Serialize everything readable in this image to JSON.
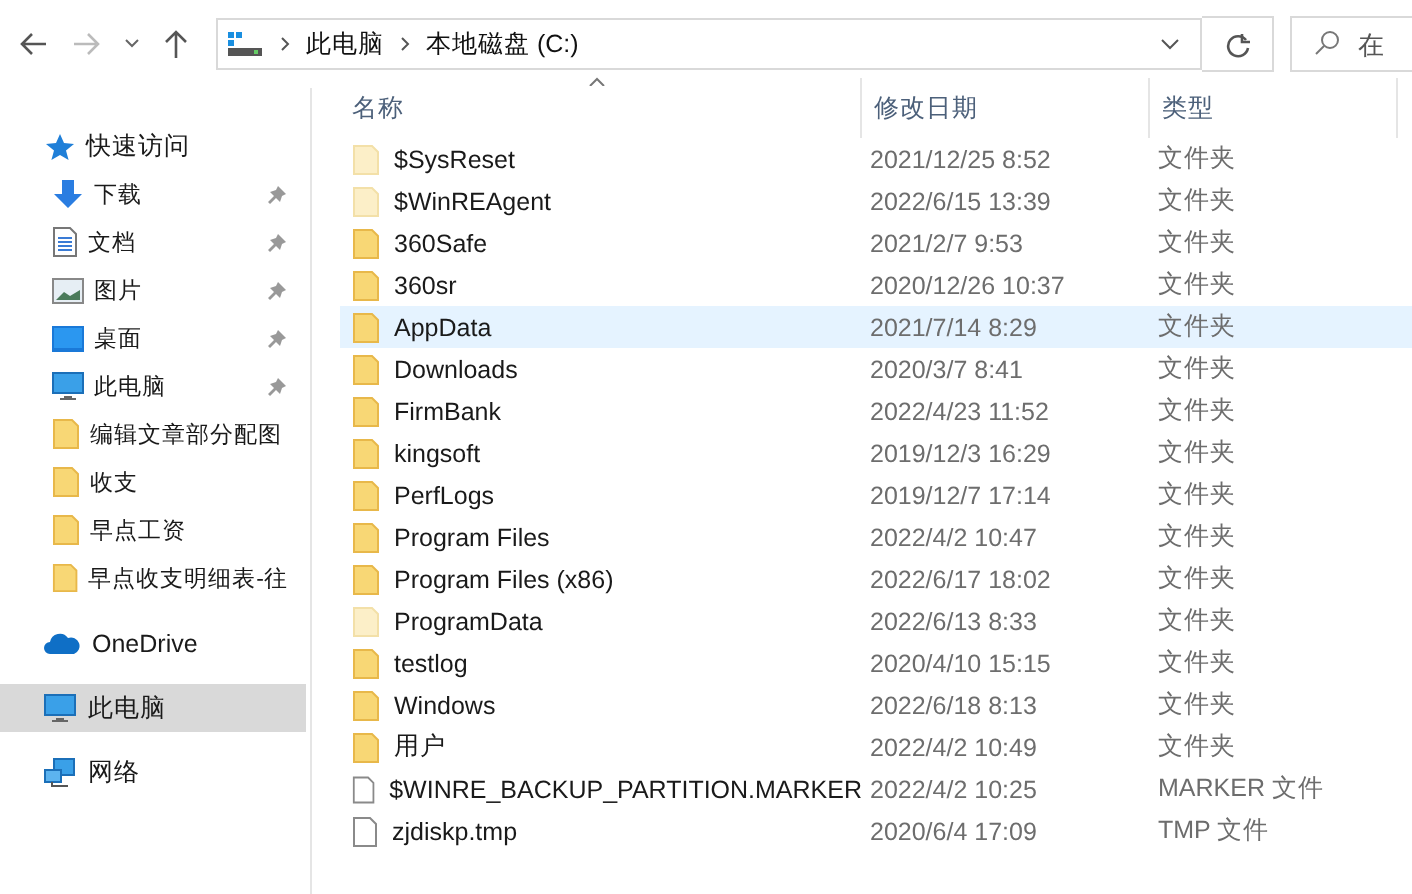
{
  "toolbar": {
    "path": [
      "此电脑",
      "本地磁盘 (C:)"
    ],
    "search": {
      "placeholder": "在"
    }
  },
  "sidebar": {
    "items": [
      {
        "label": "快速访问",
        "kind": "quick",
        "selected": false,
        "children": [
          {
            "label": "下载",
            "kind": "download",
            "pinned": true
          },
          {
            "label": "文档",
            "kind": "document",
            "pinned": true
          },
          {
            "label": "图片",
            "kind": "picture",
            "pinned": true
          },
          {
            "label": "桌面",
            "kind": "desktop",
            "pinned": true
          },
          {
            "label": "此电脑",
            "kind": "pc",
            "pinned": true
          },
          {
            "label": "编辑文章部分配图",
            "kind": "folder",
            "pinned": false
          },
          {
            "label": "收支",
            "kind": "folder",
            "pinned": false
          },
          {
            "label": "早点工资",
            "kind": "folder",
            "pinned": false
          },
          {
            "label": "早点收支明细表-往",
            "kind": "folder",
            "pinned": false
          }
        ]
      },
      {
        "label": "OneDrive",
        "kind": "cloud",
        "selected": false
      },
      {
        "label": "此电脑",
        "kind": "pc",
        "selected": true
      },
      {
        "label": "网络",
        "kind": "network",
        "selected": false
      }
    ]
  },
  "table": {
    "columns": [
      "名称",
      "修改日期",
      "类型"
    ],
    "rows": [
      {
        "name": "$SysReset",
        "date": "2021/12/25 8:52",
        "type": "文件夹",
        "kind": "folder",
        "hidden": true,
        "selected": false
      },
      {
        "name": "$WinREAgent",
        "date": "2022/6/15 13:39",
        "type": "文件夹",
        "kind": "folder",
        "hidden": true,
        "selected": false
      },
      {
        "name": "360Safe",
        "date": "2021/2/7 9:53",
        "type": "文件夹",
        "kind": "folder",
        "hidden": false,
        "selected": false
      },
      {
        "name": "360sr",
        "date": "2020/12/26 10:37",
        "type": "文件夹",
        "kind": "folder",
        "hidden": false,
        "selected": false
      },
      {
        "name": "AppData",
        "date": "2021/7/14 8:29",
        "type": "文件夹",
        "kind": "folder",
        "hidden": false,
        "selected": true
      },
      {
        "name": "Downloads",
        "date": "2020/3/7 8:41",
        "type": "文件夹",
        "kind": "folder",
        "hidden": false,
        "selected": false
      },
      {
        "name": "FirmBank",
        "date": "2022/4/23 11:52",
        "type": "文件夹",
        "kind": "folder",
        "hidden": false,
        "selected": false
      },
      {
        "name": "kingsoft",
        "date": "2019/12/3 16:29",
        "type": "文件夹",
        "kind": "folder",
        "hidden": false,
        "selected": false
      },
      {
        "name": "PerfLogs",
        "date": "2019/12/7 17:14",
        "type": "文件夹",
        "kind": "folder",
        "hidden": false,
        "selected": false
      },
      {
        "name": "Program Files",
        "date": "2022/4/2 10:47",
        "type": "文件夹",
        "kind": "folder",
        "hidden": false,
        "selected": false
      },
      {
        "name": "Program Files (x86)",
        "date": "2022/6/17 18:02",
        "type": "文件夹",
        "kind": "folder",
        "hidden": false,
        "selected": false
      },
      {
        "name": "ProgramData",
        "date": "2022/6/13 8:33",
        "type": "文件夹",
        "kind": "folder",
        "hidden": true,
        "selected": false
      },
      {
        "name": "testlog",
        "date": "2020/4/10 15:15",
        "type": "文件夹",
        "kind": "folder",
        "hidden": false,
        "selected": false
      },
      {
        "name": "Windows",
        "date": "2022/6/18 8:13",
        "type": "文件夹",
        "kind": "folder",
        "hidden": false,
        "selected": false
      },
      {
        "name": "用户",
        "date": "2022/4/2 10:49",
        "type": "文件夹",
        "kind": "folder",
        "hidden": false,
        "selected": false
      },
      {
        "name": "$WINRE_BACKUP_PARTITION.MARKER",
        "date": "2022/4/2 10:25",
        "type": "MARKER 文件",
        "kind": "file",
        "hidden": false,
        "selected": false
      },
      {
        "name": "zjdiskp.tmp",
        "date": "2020/6/4 17:09",
        "type": "TMP 文件",
        "kind": "file",
        "hidden": false,
        "selected": false
      }
    ]
  }
}
